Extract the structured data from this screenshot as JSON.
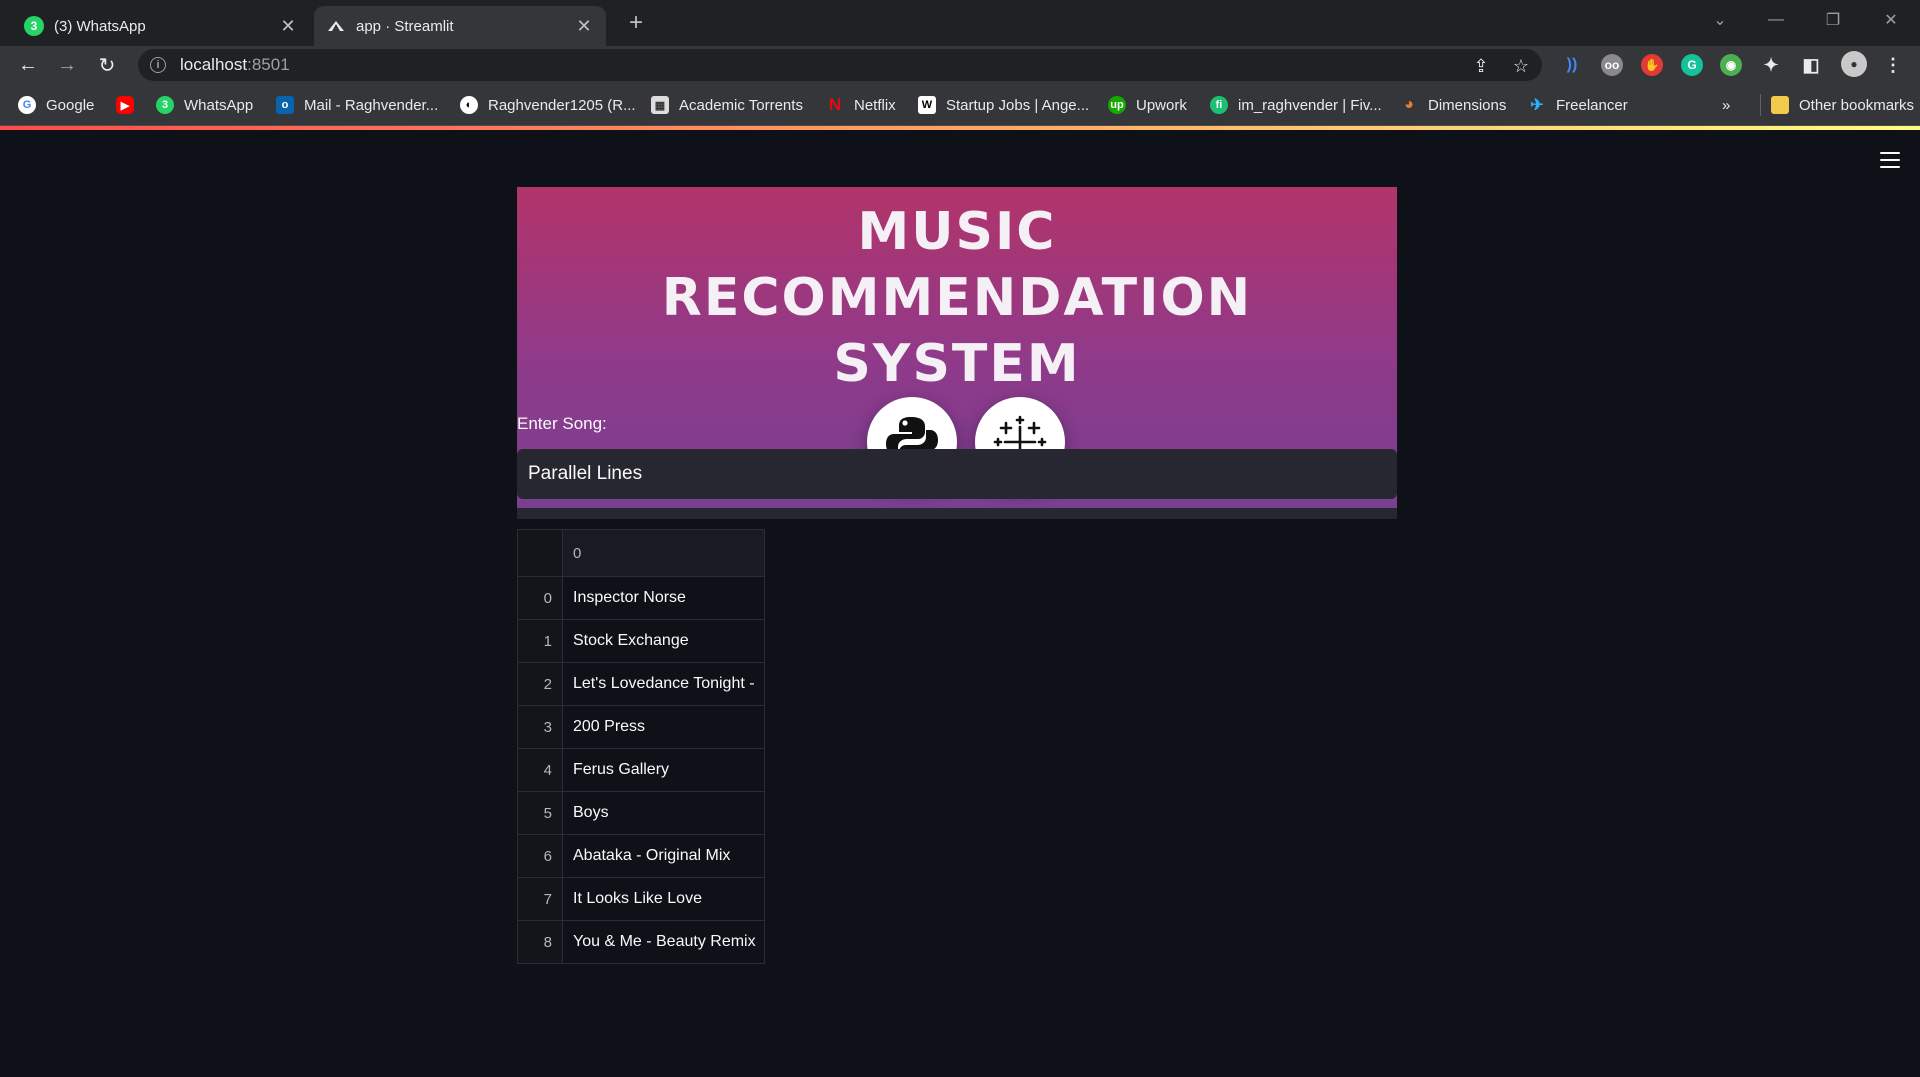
{
  "browser": {
    "tabs": [
      {
        "title": "(3) WhatsApp",
        "icon": "whatsapp-icon",
        "active": false
      },
      {
        "title": "app · Streamlit",
        "icon": "streamlit-icon",
        "active": true
      }
    ],
    "address": {
      "host": "localhost",
      "port": ":8501"
    },
    "bookmarks": [
      {
        "label": "Google",
        "icon": "google-icon",
        "color": "#4285f4"
      },
      {
        "label": "",
        "icon": "youtube-icon",
        "color": "#ff0000"
      },
      {
        "label": "WhatsApp",
        "icon": "whatsapp-icon",
        "color": "#25d366"
      },
      {
        "label": "Mail - Raghvender...",
        "icon": "outlook-icon",
        "color": "#0a64ad"
      },
      {
        "label": "Raghvender1205 (R...",
        "icon": "github-icon",
        "color": "#ffffff"
      },
      {
        "label": "Academic Torrents",
        "icon": "academic-torrents-icon",
        "color": "#dddddd"
      },
      {
        "label": "Netflix",
        "icon": "netflix-icon",
        "color": "#e50914"
      },
      {
        "label": "Startup Jobs | Ange...",
        "icon": "angellist-icon",
        "color": "#ffffff"
      },
      {
        "label": "Upwork",
        "icon": "upwork-icon",
        "color": "#14a800"
      },
      {
        "label": "im_raghvender | Fiv...",
        "icon": "fiverr-icon",
        "color": "#1dbf73"
      },
      {
        "label": "Dimensions",
        "icon": "dimensions-icon",
        "color": "#e37c3b"
      },
      {
        "label": "Freelancer",
        "icon": "freelancer-icon",
        "color": "#29b2fe"
      }
    ],
    "overflow_label": "»",
    "other_bookmarks": "Other bookmarks"
  },
  "app": {
    "banner": {
      "title_lines": [
        "MUSIC",
        "RECOMMENDATION",
        "SYSTEM"
      ],
      "logos": [
        "python-icon",
        "tableau-icon"
      ],
      "gradient": [
        "#b2346a",
        "#7a3f92"
      ]
    },
    "input_label": "Enter Song:",
    "input_value": "Parallel Lines",
    "table": {
      "column_header": "0",
      "rows": [
        {
          "index": "0",
          "value": "Inspector Norse"
        },
        {
          "index": "1",
          "value": "Stock Exchange"
        },
        {
          "index": "2",
          "value": "Let's Lovedance Tonight -"
        },
        {
          "index": "3",
          "value": "200 Press"
        },
        {
          "index": "4",
          "value": "Ferus Gallery"
        },
        {
          "index": "5",
          "value": "Boys"
        },
        {
          "index": "6",
          "value": "Abataka - Original Mix"
        },
        {
          "index": "7",
          "value": "It Looks Like Love"
        },
        {
          "index": "8",
          "value": "You & Me - Beauty Remix"
        }
      ]
    }
  }
}
